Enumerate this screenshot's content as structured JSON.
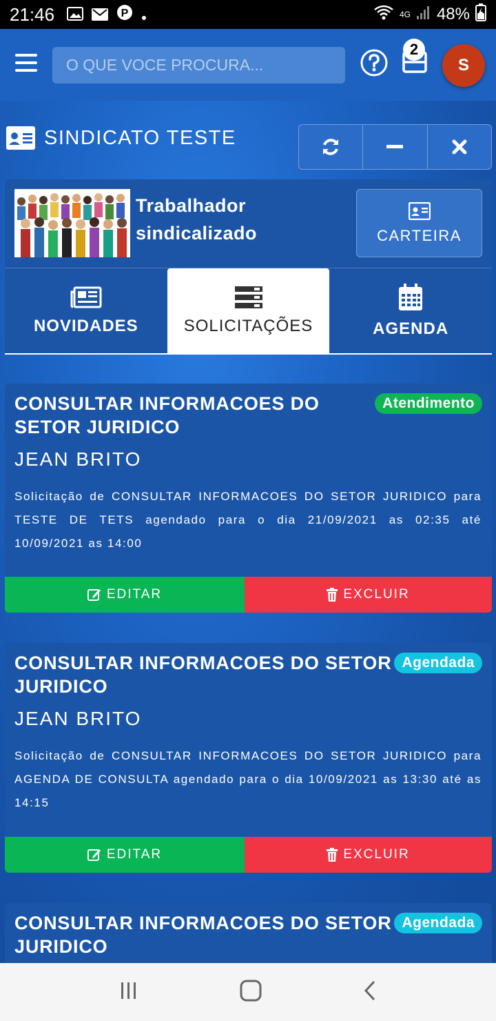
{
  "status_bar": {
    "time": "21:46",
    "network": "4G",
    "battery": "48%"
  },
  "header": {
    "search_placeholder": "O QUE VOCE PROCURA...",
    "cart_count": "2",
    "avatar_initial": "S"
  },
  "section": {
    "title": "SINDICATO TESTE"
  },
  "profile": {
    "name_line1": "Trabalhador",
    "name_line2": "sindicalizado",
    "card_button": "CARTEIRA"
  },
  "tabs": [
    {
      "label": "NOVIDADES",
      "icon": "newspaper-icon",
      "active": false
    },
    {
      "label": "SOLICITAÇÕES",
      "icon": "server-icon",
      "active": true
    },
    {
      "label": "AGENDA",
      "icon": "calendar-icon",
      "active": false
    }
  ],
  "requests": [
    {
      "title": "CONSULTAR INFORMACOES DO SETOR JURIDICO",
      "title_line1": "CONSULTAR INFORMACOES DO",
      "title_line2": "SETOR JURIDICO",
      "status": "Atendimento",
      "person": "JEAN BRITO",
      "description": "Solicitação de CONSULTAR INFORMACOES DO SETOR JURIDICO para TESTE DE TETS agendado para o dia 21/09/2021 as 02:35 até 10/09/2021 as 14:00",
      "edit_label": "EDITAR",
      "delete_label": "EXCLUIR"
    },
    {
      "title": "CONSULTAR INFORMACOES DO SETOR JURIDICO",
      "title_line1": "CONSULTAR INFORMACOES DO SETOR",
      "title_line2": "JURIDICO",
      "status": "Agendada",
      "person": "JEAN BRITO",
      "description": "Solicitação de CONSULTAR INFORMACOES DO SETOR JURIDICO para AGENDA DE CONSULTA agendado para o dia 10/09/2021 as 13:30 até as 14:15",
      "edit_label": "EDITAR",
      "delete_label": "EXCLUIR"
    },
    {
      "title": "CONSULTAR INFORMACOES DO SETOR JURIDICO",
      "title_line1": "CONSULTAR INFORMACOES DO SETOR",
      "title_line2": "JURIDICO",
      "status": "Agendada"
    }
  ],
  "colors": {
    "status_atendimento": "#0fb454",
    "status_agendada": "#14c3e0",
    "edit": "#0ab556",
    "delete": "#f03545",
    "avatar": "#c53a16"
  }
}
